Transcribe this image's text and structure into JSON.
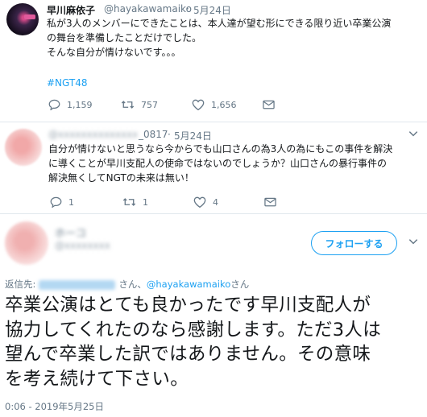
{
  "tweet1": {
    "name": "早川麻依子",
    "handle": "@hayakawamaiko",
    "date": "5月24日",
    "text_line1": "私が3人のメンバーにできたことは、本人達が望む形にできる限り近い卒業公演",
    "text_line2": "の舞台を準備したことだけでした。",
    "text_line3": "そんな自分が情けないです。。。",
    "hashtag": "#NGT48",
    "replies": "1,159",
    "retweets": "757",
    "likes": "1,656"
  },
  "tweet2": {
    "handle_blurred": "@xxxxxxxxxxxxxx",
    "handle_suffix": "_0817",
    "date": "5月24日",
    "text_line1": "自分が情けないと思うなら今からでも山口さんの為3人の為にもこの事件を解決",
    "text_line2": "に導くことが早川支配人の使命ではないのでしょうか？山口さんの暴行事件の",
    "text_line3": "解決無くしてNGTの未来は無い！",
    "replies": "1",
    "retweets": "1",
    "likes": "4"
  },
  "tweet3": {
    "name_blurred": "ホーコ",
    "handle_blurred": "@xxxxxxxx",
    "follow_label": "フォローする",
    "replying_prefix": "返信先:",
    "replying_mid": "さん、",
    "replying_mention": "@hayakawamaiko",
    "replying_suffix": "さん",
    "text_line1": "卒業公演はとても良かったです早川支配人が",
    "text_line2": "協力してくれたのなら感謝します。ただ3人は",
    "text_line3": "望んで卒業した訳ではありません。その意味",
    "text_line4": "を考え続けて下さい。",
    "timestamp": "0:06 - 2019年5月25日"
  },
  "icons": [
    "reply-icon",
    "retweet-icon",
    "like-icon",
    "dm-icon",
    "chevron-down-icon"
  ],
  "colors": {
    "accent": "#1da1f2",
    "muted": "#657786",
    "text": "#14171a",
    "divider": "#e1e8ed"
  }
}
